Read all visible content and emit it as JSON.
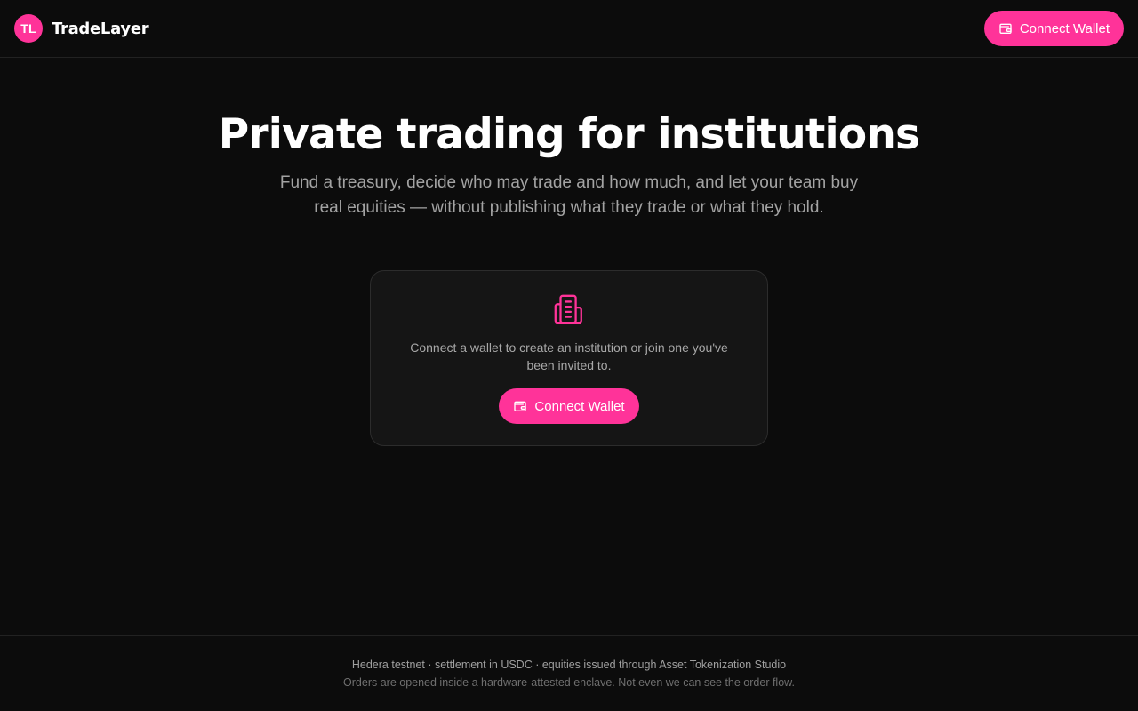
{
  "header": {
    "logo_initials": "TL",
    "brand_name": "TradeLayer",
    "connect_button_label": "Connect Wallet",
    "connect_button_icon": "wallet-icon"
  },
  "hero": {
    "title": "Private trading for institutions",
    "subtitle": "Fund a treasury, decide who may trade and how much, and let your team buy real equities — without publishing what they trade or what they hold."
  },
  "card": {
    "icon": "building-icon",
    "message": "Connect a wallet to create an institution or join one you've been invited to.",
    "connect_button_label": "Connect Wallet",
    "connect_button_icon": "wallet-icon"
  },
  "footer": {
    "line1": "Hedera testnet · settlement in USDC · equities issued through Asset Tokenization Studio",
    "line2": "Orders are opened inside a hardware-attested enclave. Not even we can see the order flow."
  },
  "colors": {
    "background": "#0c0c0c",
    "accent": "#ff3399",
    "card_background": "#151515",
    "muted_text": "#a3a3a3"
  }
}
